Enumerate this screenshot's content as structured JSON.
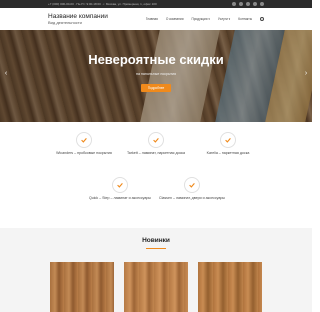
{
  "topbar": {
    "info": "+7 (000) 000-00-00  ·  Пн-Пт: 9:00-18:00  ·  г. Москва, ул. Примерная, 1, офис 100",
    "social_icons": [
      "facebook-icon",
      "twitter-icon",
      "vk-icon",
      "instagram-icon",
      "youtube-icon"
    ]
  },
  "header": {
    "company_name": "Название компании",
    "company_sub": "Вид деятельности",
    "nav": [
      "Главная",
      "О компании",
      "Продукция ▾",
      "Услуги ▾",
      "Контакты"
    ]
  },
  "hero": {
    "title": "Невероятные скидки",
    "subtitle": "на напольные покрытия",
    "button": "Подробнее",
    "prev": "‹",
    "next": "›"
  },
  "features": [
    {
      "text": "Wicanders – пробковые покрытия"
    },
    {
      "text": "Tarkett – ламинат, паркетная доска"
    },
    {
      "text": "Karelia – паркетная доска"
    },
    {
      "text": "Quick – Step – ламинат и аксессуары"
    },
    {
      "text": "Classen – ламинат, двери и аксессуары"
    }
  ],
  "news": {
    "title": "Новинки"
  },
  "colors": {
    "accent": "#f08a1c",
    "topbar": "#2b2b2b"
  }
}
